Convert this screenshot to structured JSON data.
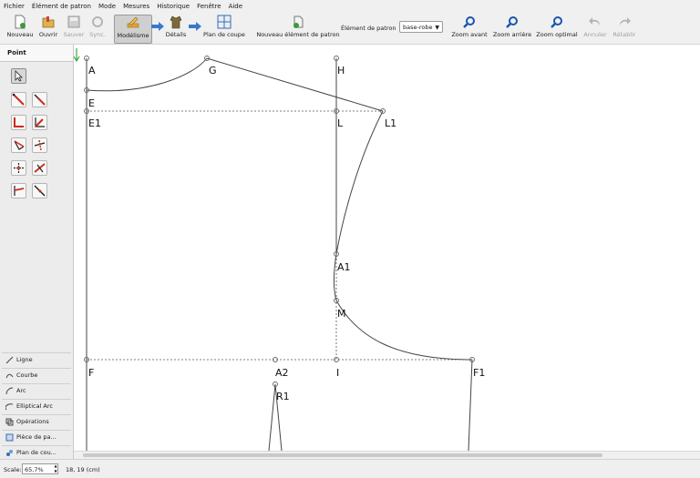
{
  "menu": [
    "Fichier",
    "Élément de patron",
    "Mode",
    "Mesures",
    "Historique",
    "Fenêtre",
    "Aide"
  ],
  "toolbar": {
    "new": "Nouveau",
    "open": "Ouvrir",
    "save": "Sauver",
    "sync": "Sync.",
    "modeling": "Modélisme",
    "details": "Détails",
    "layout": "Plan de coupe",
    "new_piece": "Nouveau élément de patron",
    "piece_label": "Élément de patron",
    "piece_value": "base-robe",
    "zoom_in": "Zoom avant",
    "zoom_out": "Zoom arrière",
    "zoom_fit": "Zoom optimal",
    "undo": "Annuler",
    "redo": "Rétablir"
  },
  "tools": {
    "point_tab": "Point",
    "categories": [
      "Ligne",
      "Courbe",
      "Arc",
      "Elliptical Arc",
      "Opérations",
      "Pièce de pa...",
      "Plan de cou..."
    ]
  },
  "drawing": {
    "points": {
      "A": "A",
      "G": "G",
      "H": "H",
      "E": "E",
      "E1": "E1",
      "L": "L",
      "L1": "L1",
      "A1": "A1",
      "M": "M",
      "F": "F",
      "A2": "A2",
      "I": "I",
      "F1": "F1",
      "R1": "R1"
    }
  },
  "status": {
    "scale_label": "Scale:",
    "scale_value": "65,7%",
    "coords": "18, 19 (cm)"
  },
  "colors": {
    "line": "#444444",
    "guide": "#555555",
    "point": "#666666",
    "origin": "#3aa63a",
    "tool_red": "#cc2a1e",
    "tool_black": "#222222",
    "zoom_blue": "#1a56b0"
  }
}
